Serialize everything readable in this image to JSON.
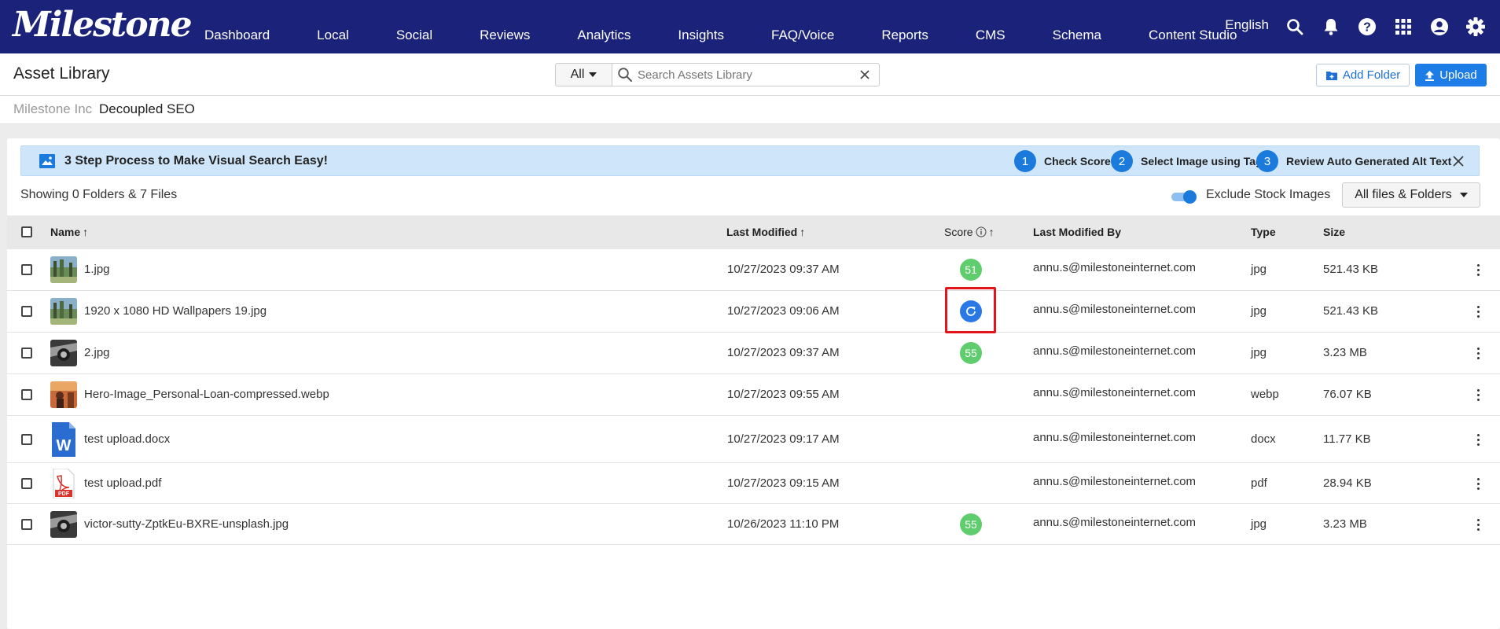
{
  "nav": {
    "logo": "Milestone",
    "items": [
      "Dashboard",
      "Local",
      "Social",
      "Reviews",
      "Analytics",
      "Insights",
      "FAQ/Voice",
      "Reports",
      "CMS",
      "Schema",
      "Content Studio"
    ],
    "language": "English"
  },
  "header": {
    "title": "Asset Library",
    "scope": "All",
    "search_placeholder": "Search Assets Library",
    "add_folder": "Add Folder",
    "upload": "Upload"
  },
  "breadcrumb": {
    "parent": "Milestone Inc",
    "current": "Decoupled SEO"
  },
  "banner": {
    "title": "3 Step Process to Make Visual Search Easy!",
    "steps": [
      {
        "num": "1",
        "label": "Check Score"
      },
      {
        "num": "2",
        "label": "Select Image using Tags"
      },
      {
        "num": "3",
        "label": "Review Auto Generated Alt Text"
      }
    ]
  },
  "toolbar": {
    "showing": "Showing 0 Folders & 7 Files",
    "exclude_stock": "Exclude Stock Images",
    "exclude_stock_on": true,
    "filter": "All files & Folders"
  },
  "table": {
    "columns": {
      "name": "Name",
      "modified": "Last Modified",
      "score": "Score",
      "modified_by": "Last Modified By",
      "type": "Type",
      "size": "Size"
    },
    "rows": [
      {
        "name": "1.jpg",
        "modified": "10/27/2023 09:37 AM",
        "score": "51",
        "modified_by": "annu.s@milestoneinternet.com",
        "type": "jpg",
        "size": "521.43 KB"
      },
      {
        "name": "1920 x 1080 HD Wallpapers 19.jpg",
        "modified": "10/27/2023 09:06 AM",
        "score": "",
        "modified_by": "annu.s@milestoneinternet.com",
        "type": "jpg",
        "size": "521.43 KB"
      },
      {
        "name": "2.jpg",
        "modified": "10/27/2023 09:37 AM",
        "score": "55",
        "modified_by": "annu.s@milestoneinternet.com",
        "type": "jpg",
        "size": "3.23 MB"
      },
      {
        "name": "Hero-Image_Personal-Loan-compressed.webp",
        "modified": "10/27/2023 09:55 AM",
        "score": "",
        "modified_by": "annu.s@milestoneinternet.com",
        "type": "webp",
        "size": "76.07 KB"
      },
      {
        "name": "test upload.docx",
        "modified": "10/27/2023 09:17 AM",
        "score": "",
        "modified_by": "annu.s@milestoneinternet.com",
        "type": "docx",
        "size": "11.77 KB"
      },
      {
        "name": "test upload.pdf",
        "modified": "10/27/2023 09:15 AM",
        "score": "",
        "modified_by": "annu.s@milestoneinternet.com",
        "type": "pdf",
        "size": "28.94 KB"
      },
      {
        "name": "victor-sutty-ZptkEu-BXRE-unsplash.jpg",
        "modified": "10/26/2023 11:10 PM",
        "score": "55",
        "modified_by": "annu.s@milestoneinternet.com",
        "type": "jpg",
        "size": "3.23 MB"
      }
    ]
  },
  "colors": {
    "nav_bg": "#1b2279",
    "accent": "#1e7ce6",
    "score_green": "#5fcd6e",
    "highlight": "#e3141b"
  }
}
